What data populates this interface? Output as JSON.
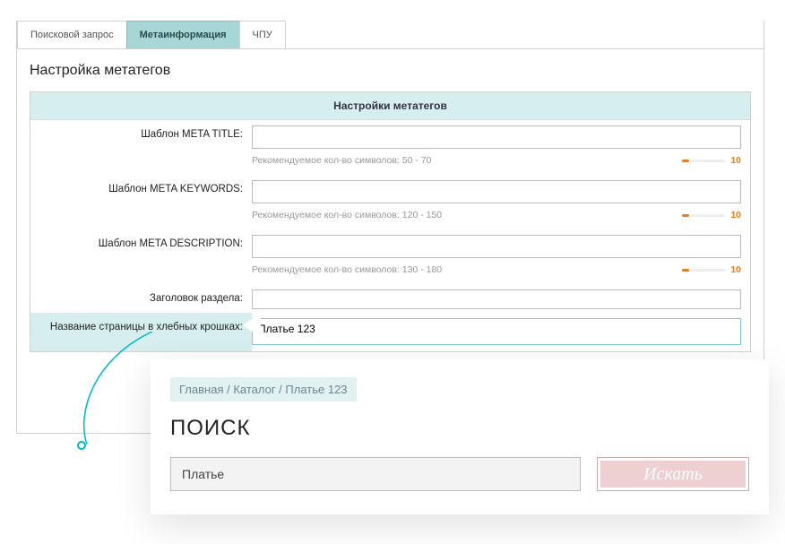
{
  "tabs": {
    "search": "Поисковой запрос",
    "meta": "Метаинформация",
    "chpu": "ЧПУ"
  },
  "panel": {
    "title": "Настройка метатегов",
    "section_header": "Настройки метатегов"
  },
  "fields": {
    "title": {
      "label": "Шаблон META TITLE:",
      "value": "",
      "hint": "Рекомендуемое кол-во символов: 50 - 70",
      "count": "10"
    },
    "keywords": {
      "label": "Шаблон META KEYWORDS:",
      "value": "",
      "hint": "Рекомендуемое кол-во символов: 120 - 150",
      "count": "10"
    },
    "description": {
      "label": "Шаблон META DESCRIPTION:",
      "value": "",
      "hint": "Рекомендуемое кол-во символов: 130 - 180",
      "count": "10"
    },
    "heading": {
      "label": "Заголовок раздела:",
      "value": ""
    },
    "breadcrumb": {
      "label": "Название страницы в хлебных крошках:",
      "value": "Платье 123"
    }
  },
  "preview": {
    "breadcrumbs": "Главная / Каталог / Платье 123",
    "search_title": "ПОИСК",
    "search_value": "Платье",
    "search_button": "Искать"
  }
}
